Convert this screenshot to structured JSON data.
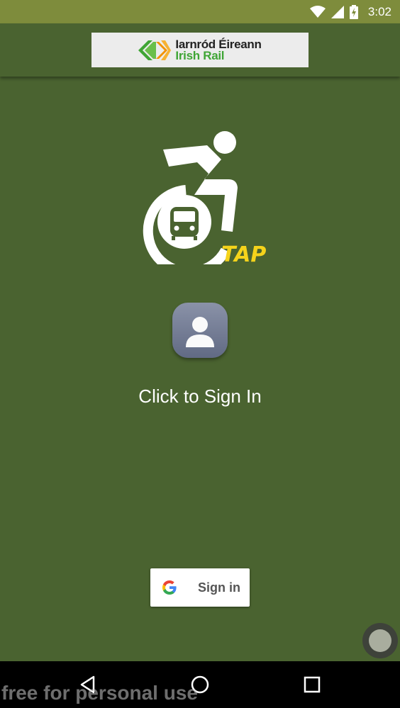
{
  "status_bar": {
    "time": "3:02",
    "icons": [
      "wifi-icon",
      "cell-signal-icon",
      "battery-charging-icon"
    ]
  },
  "header": {
    "logo_line1": "Iarnród Éireann",
    "logo_line2": "Irish Rail"
  },
  "main": {
    "app_logo_text": "TAP",
    "avatar_icon": "person-icon",
    "sign_in_prompt": "Click to Sign In",
    "google_button_label": "Sign in"
  },
  "nav_bar": {
    "buttons": [
      "back-icon",
      "home-icon",
      "recents-icon"
    ]
  },
  "watermark": "free for personal use",
  "colors": {
    "status_bar": "#7e8c3c",
    "background": "#4a6330",
    "tap_yellow": "#f5d31b",
    "logo_green": "#3fa535",
    "logo_orange": "#f39200"
  }
}
